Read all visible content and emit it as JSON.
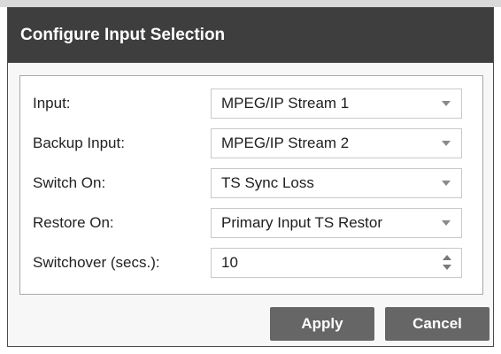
{
  "dialog": {
    "title": "Configure Input Selection"
  },
  "form": {
    "input": {
      "label": "Input:",
      "value": "MPEG/IP Stream 1"
    },
    "backup_input": {
      "label": "Backup Input:",
      "value": "MPEG/IP Stream 2"
    },
    "switch_on": {
      "label": "Switch On:",
      "value": "TS Sync Loss"
    },
    "restore_on": {
      "label": "Restore On:",
      "value": "Primary Input TS Restor"
    },
    "switchover": {
      "label": "Switchover (secs.):",
      "value": "10"
    }
  },
  "buttons": {
    "apply": "Apply",
    "cancel": "Cancel"
  },
  "icons": {
    "dropdown": "chevron-down-icon",
    "spinner": "spinner-updown-icon"
  },
  "colors": {
    "titlebar": "#3e3e3e",
    "button": "#666666",
    "dialog_bg": "#f7f7f7"
  }
}
